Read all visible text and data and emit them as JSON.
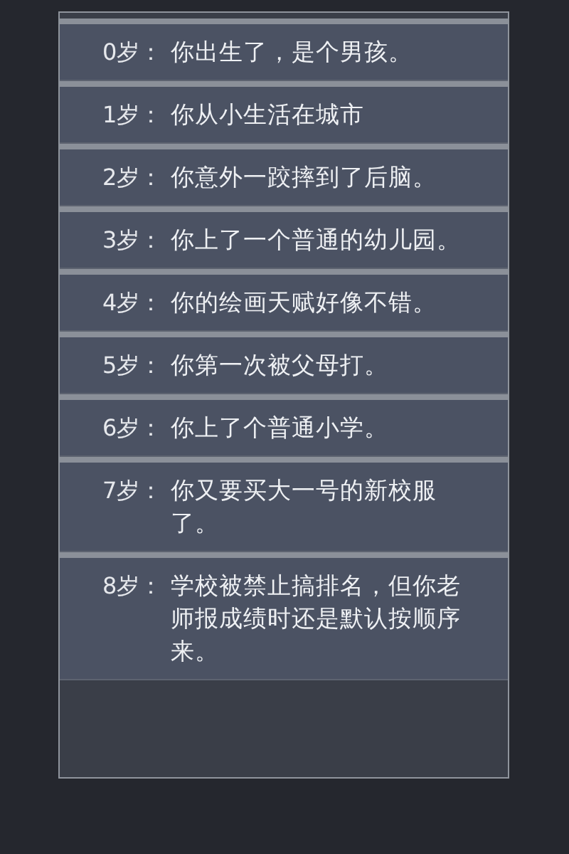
{
  "events": [
    {
      "age": "0岁：",
      "text": "你出生了，是个男孩。"
    },
    {
      "age": "1岁：",
      "text": "你从小生活在城市"
    },
    {
      "age": "2岁：",
      "text": "你意外一跤摔到了后脑。"
    },
    {
      "age": "3岁：",
      "text": "你上了一个普通的幼儿园。"
    },
    {
      "age": "4岁：",
      "text": "你的绘画天赋好像不错。"
    },
    {
      "age": "5岁：",
      "text": "你第一次被父母打。"
    },
    {
      "age": "6岁：",
      "text": "你上了个普通小学。"
    },
    {
      "age": "7岁：",
      "text": "你又要买大一号的新校服了。"
    },
    {
      "age": "8岁：",
      "text": "学校被禁止搞排名，但你老师报成绩时还是默认按顺序来。"
    }
  ]
}
